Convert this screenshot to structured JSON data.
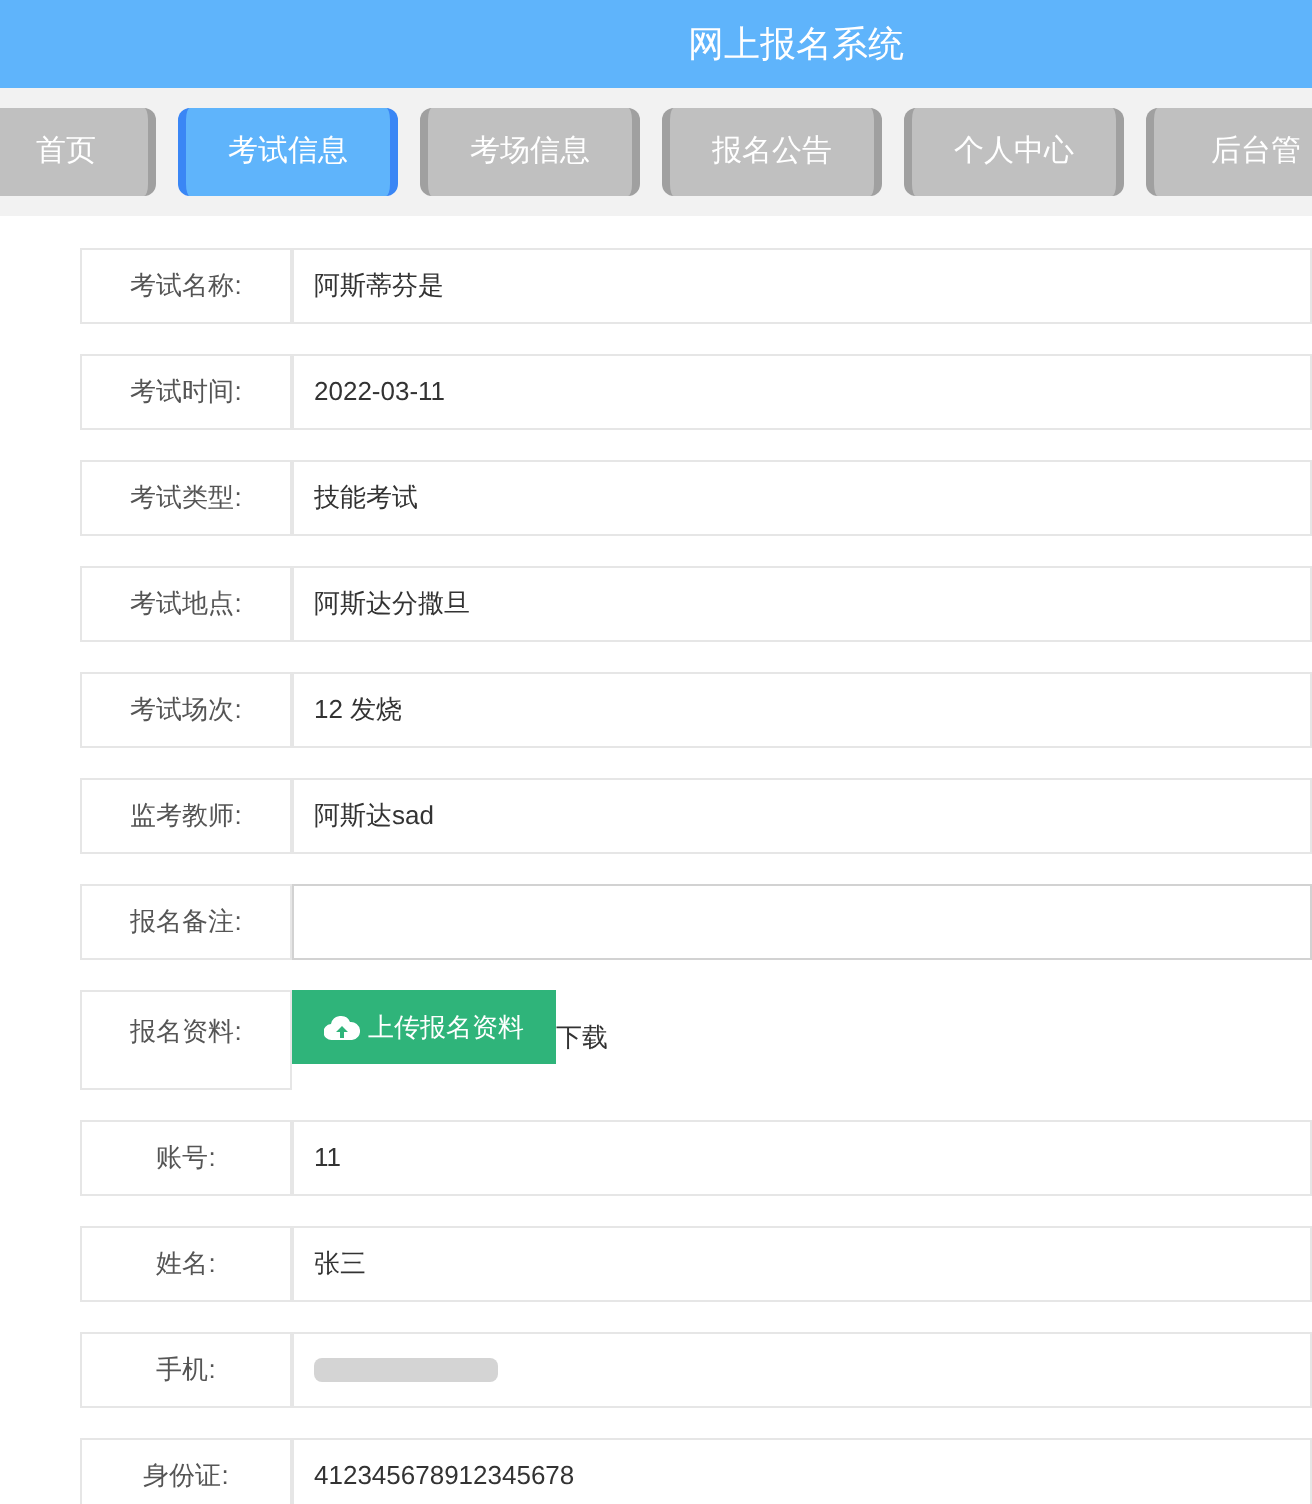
{
  "header": {
    "title": "网上报名系统"
  },
  "tabs": [
    {
      "label": "首页",
      "selected": false
    },
    {
      "label": "考试信息",
      "selected": true
    },
    {
      "label": "考场信息",
      "selected": false
    },
    {
      "label": "报名公告",
      "selected": false
    },
    {
      "label": "个人中心",
      "selected": false
    },
    {
      "label": "后台管",
      "selected": false
    }
  ],
  "form": [
    {
      "kind": "text",
      "label": "考试名称:",
      "value": "阿斯蒂芬是"
    },
    {
      "kind": "text",
      "label": "考试时间:",
      "value": "2022-03-11"
    },
    {
      "kind": "text",
      "label": "考试类型:",
      "value": "技能考试"
    },
    {
      "kind": "text",
      "label": "考试地点:",
      "value": "阿斯达分撒旦"
    },
    {
      "kind": "text",
      "label": "考试场次:",
      "value": "12 发烧"
    },
    {
      "kind": "text",
      "label": "监考教师:",
      "value": "阿斯达sad"
    },
    {
      "kind": "input",
      "label": "报名备注:"
    },
    {
      "kind": "upload",
      "label": "报名资料:",
      "button": "上传报名资料",
      "link": "下载"
    },
    {
      "kind": "text",
      "label": "账号:",
      "value": "11"
    },
    {
      "kind": "text",
      "label": "姓名:",
      "value": "张三"
    },
    {
      "kind": "redacted",
      "label": "手机:"
    },
    {
      "kind": "text",
      "label": "身份证:",
      "value": "412345678912345678"
    }
  ]
}
